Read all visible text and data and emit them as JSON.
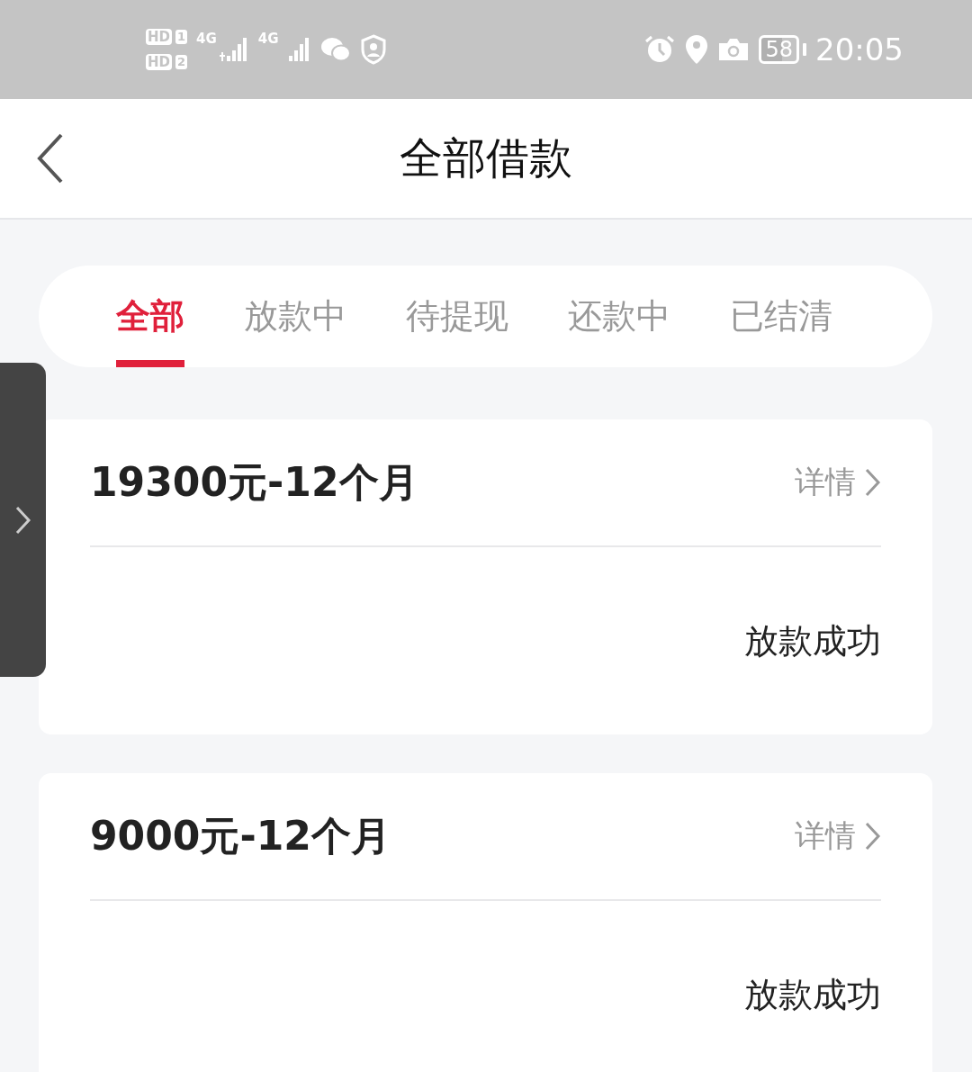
{
  "status_bar": {
    "sim_labels": [
      {
        "hd": "HD",
        "slot": "1"
      },
      {
        "hd": "HD",
        "slot": "2"
      }
    ],
    "networks": [
      "4G",
      "4G"
    ],
    "battery": "58",
    "time": "20:05"
  },
  "header": {
    "title": "全部借款"
  },
  "tabs": [
    {
      "label": "全部",
      "selected": true
    },
    {
      "label": "放款中",
      "selected": false
    },
    {
      "label": "待提现",
      "selected": false
    },
    {
      "label": "还款中",
      "selected": false
    },
    {
      "label": "已结清",
      "selected": false
    }
  ],
  "loans": [
    {
      "title": "19300元-12个月",
      "detail": "详情",
      "status": "放款成功"
    },
    {
      "title": "9000元-12个月",
      "detail": "详情",
      "status": "放款成功"
    }
  ]
}
